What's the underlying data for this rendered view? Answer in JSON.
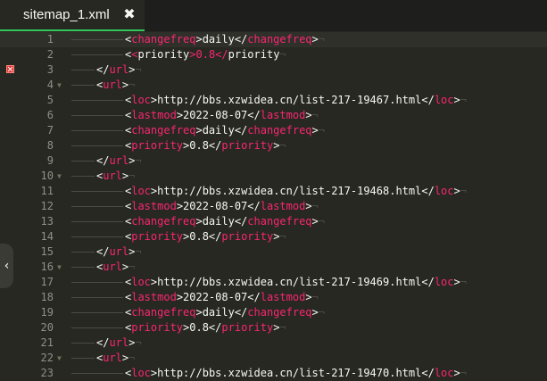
{
  "tab": {
    "title": "sitemap_1.xml",
    "close_label": "✖"
  },
  "sidebar_toggle": "‹",
  "lines": [
    {
      "n": "1",
      "indent": 2,
      "fold": false,
      "mark": false,
      "current": true,
      "parts": [
        [
          "<",
          ""
        ],
        [
          "changefreq",
          "tag"
        ],
        [
          ">daily</",
          ""
        ],
        [
          "changefreq",
          "tag"
        ],
        [
          ">",
          ""
        ]
      ]
    },
    {
      "n": "2",
      "indent": 2,
      "fold": false,
      "mark": false,
      "current": false,
      "parts": [
        [
          "priority",
          "tag"
        ],
        [
          ">0.8</",
          ""
        ],
        [
          "priority",
          "tag"
        ],
        [
          ">",
          ""
        ]
      ],
      "lead": "<"
    },
    {
      "n": "3",
      "indent": 1,
      "fold": false,
      "mark": true,
      "current": false,
      "parts": [
        [
          "</",
          ""
        ],
        [
          "url",
          "tag"
        ],
        [
          ">",
          ""
        ]
      ]
    },
    {
      "n": "4",
      "indent": 1,
      "fold": true,
      "mark": false,
      "current": false,
      "parts": [
        [
          "<",
          ""
        ],
        [
          "url",
          "tag"
        ],
        [
          ">",
          ""
        ]
      ]
    },
    {
      "n": "5",
      "indent": 2,
      "fold": false,
      "mark": false,
      "current": false,
      "parts": [
        [
          "<",
          ""
        ],
        [
          "loc",
          "tag"
        ],
        [
          ">http://bbs.xzwidea.cn/list-217-19467.html</",
          ""
        ],
        [
          "loc",
          "tag"
        ],
        [
          ">",
          ""
        ]
      ]
    },
    {
      "n": "6",
      "indent": 2,
      "fold": false,
      "mark": false,
      "current": false,
      "parts": [
        [
          "<",
          ""
        ],
        [
          "lastmod",
          "tag"
        ],
        [
          ">2022-08-07</",
          ""
        ],
        [
          "lastmod",
          "tag"
        ],
        [
          ">",
          ""
        ]
      ]
    },
    {
      "n": "7",
      "indent": 2,
      "fold": false,
      "mark": false,
      "current": false,
      "parts": [
        [
          "<",
          ""
        ],
        [
          "changefreq",
          "tag"
        ],
        [
          ">daily</",
          ""
        ],
        [
          "changefreq",
          "tag"
        ],
        [
          ">",
          ""
        ]
      ]
    },
    {
      "n": "8",
      "indent": 2,
      "fold": false,
      "mark": false,
      "current": false,
      "parts": [
        [
          "<",
          ""
        ],
        [
          "priority",
          "tag"
        ],
        [
          ">0.8</",
          ""
        ],
        [
          "priority",
          "tag"
        ],
        [
          ">",
          ""
        ]
      ]
    },
    {
      "n": "9",
      "indent": 1,
      "fold": false,
      "mark": false,
      "current": false,
      "parts": [
        [
          "</",
          ""
        ],
        [
          "url",
          "tag"
        ],
        [
          ">",
          ""
        ]
      ]
    },
    {
      "n": "10",
      "indent": 1,
      "fold": true,
      "mark": false,
      "current": false,
      "parts": [
        [
          "<",
          ""
        ],
        [
          "url",
          "tag"
        ],
        [
          ">",
          ""
        ]
      ]
    },
    {
      "n": "11",
      "indent": 2,
      "fold": false,
      "mark": false,
      "current": false,
      "parts": [
        [
          "<",
          ""
        ],
        [
          "loc",
          "tag"
        ],
        [
          ">http://bbs.xzwidea.cn/list-217-19468.html</",
          ""
        ],
        [
          "loc",
          "tag"
        ],
        [
          ">",
          ""
        ]
      ]
    },
    {
      "n": "12",
      "indent": 2,
      "fold": false,
      "mark": false,
      "current": false,
      "parts": [
        [
          "<",
          ""
        ],
        [
          "lastmod",
          "tag"
        ],
        [
          ">2022-08-07</",
          ""
        ],
        [
          "lastmod",
          "tag"
        ],
        [
          ">",
          ""
        ]
      ]
    },
    {
      "n": "13",
      "indent": 2,
      "fold": false,
      "mark": false,
      "current": false,
      "parts": [
        [
          "<",
          ""
        ],
        [
          "changefreq",
          "tag"
        ],
        [
          ">daily</",
          ""
        ],
        [
          "changefreq",
          "tag"
        ],
        [
          ">",
          ""
        ]
      ]
    },
    {
      "n": "14",
      "indent": 2,
      "fold": false,
      "mark": false,
      "current": false,
      "parts": [
        [
          "<",
          ""
        ],
        [
          "priority",
          "tag"
        ],
        [
          ">0.8</",
          ""
        ],
        [
          "priority",
          "tag"
        ],
        [
          ">",
          ""
        ]
      ]
    },
    {
      "n": "15",
      "indent": 1,
      "fold": false,
      "mark": false,
      "current": false,
      "parts": [
        [
          "</",
          ""
        ],
        [
          "url",
          "tag"
        ],
        [
          ">",
          ""
        ]
      ]
    },
    {
      "n": "16",
      "indent": 1,
      "fold": true,
      "mark": false,
      "current": false,
      "parts": [
        [
          "<",
          ""
        ],
        [
          "url",
          "tag"
        ],
        [
          ">",
          ""
        ]
      ]
    },
    {
      "n": "17",
      "indent": 2,
      "fold": false,
      "mark": false,
      "current": false,
      "parts": [
        [
          "<",
          ""
        ],
        [
          "loc",
          "tag"
        ],
        [
          ">http://bbs.xzwidea.cn/list-217-19469.html</",
          ""
        ],
        [
          "loc",
          "tag"
        ],
        [
          ">",
          ""
        ]
      ]
    },
    {
      "n": "18",
      "indent": 2,
      "fold": false,
      "mark": false,
      "current": false,
      "parts": [
        [
          "<",
          ""
        ],
        [
          "lastmod",
          "tag"
        ],
        [
          ">2022-08-07</",
          ""
        ],
        [
          "lastmod",
          "tag"
        ],
        [
          ">",
          ""
        ]
      ]
    },
    {
      "n": "19",
      "indent": 2,
      "fold": false,
      "mark": false,
      "current": false,
      "parts": [
        [
          "<",
          ""
        ],
        [
          "changefreq",
          "tag"
        ],
        [
          ">daily</",
          ""
        ],
        [
          "changefreq",
          "tag"
        ],
        [
          ">",
          ""
        ]
      ]
    },
    {
      "n": "20",
      "indent": 2,
      "fold": false,
      "mark": false,
      "current": false,
      "parts": [
        [
          "<",
          ""
        ],
        [
          "priority",
          "tag"
        ],
        [
          ">0.8</",
          ""
        ],
        [
          "priority",
          "tag"
        ],
        [
          ">",
          ""
        ]
      ]
    },
    {
      "n": "21",
      "indent": 1,
      "fold": false,
      "mark": false,
      "current": false,
      "parts": [
        [
          "</",
          ""
        ],
        [
          "url",
          "tag"
        ],
        [
          ">",
          ""
        ]
      ]
    },
    {
      "n": "22",
      "indent": 1,
      "fold": true,
      "mark": false,
      "current": false,
      "parts": [
        [
          "<",
          ""
        ],
        [
          "url",
          "tag"
        ],
        [
          ">",
          ""
        ]
      ]
    },
    {
      "n": "23",
      "indent": 2,
      "fold": false,
      "mark": false,
      "current": false,
      "parts": [
        [
          "<",
          ""
        ],
        [
          "loc",
          "tag"
        ],
        [
          ">http://bbs.xzwidea.cn/list-217-19470.html</",
          ""
        ],
        [
          "loc",
          "tag"
        ],
        [
          ">",
          ""
        ]
      ]
    }
  ],
  "eol_marker": "¬",
  "icons": {
    "tab_close": "close-icon",
    "error_marker": "error-marker-icon",
    "fold": "fold-arrow-icon",
    "sidebar_toggle": "chevron-left-icon"
  },
  "colors": {
    "background": "#272822",
    "tag": "#f92672",
    "text": "#f8f8f2",
    "line_number": "#8f908a",
    "tab_underline": "#34c759",
    "error": "#e2312f"
  }
}
